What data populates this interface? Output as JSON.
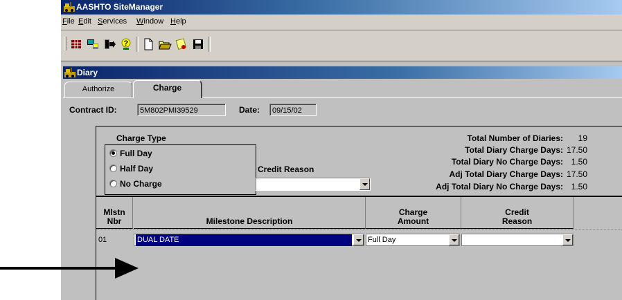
{
  "app": {
    "title": "AASHTO SiteManager"
  },
  "menu": [
    "File",
    "Edit",
    "Services",
    "Window",
    "Help"
  ],
  "menu_underline": [
    "F",
    "E",
    "S",
    "W",
    "H"
  ],
  "toolbar": {
    "icons": [
      "grid-icon",
      "workstation-icon",
      "exit-icon",
      "help-icon",
      "new-icon",
      "open-icon",
      "cut-icon",
      "save-icon"
    ]
  },
  "child_window": {
    "title": "Diary"
  },
  "tabs": [
    {
      "label": "Authorize",
      "active": false
    },
    {
      "label": "Charge",
      "active": true
    }
  ],
  "header": {
    "contract_label": "Contract ID:",
    "contract_value": "5M802PMI39529",
    "date_label": "Date:",
    "date_value": "09/15/02"
  },
  "charge_type": {
    "title": "Charge Type",
    "options": [
      {
        "label": "Full Day",
        "checked": true
      },
      {
        "label": "Half Day",
        "checked": false
      },
      {
        "label": "No Charge",
        "checked": false
      }
    ]
  },
  "credit_reason": {
    "label": "Credit Reason",
    "value": ""
  },
  "stats": [
    {
      "label": "Total Number of Diaries:",
      "value": "19"
    },
    {
      "label": "Total Diary Charge Days:",
      "value": "17.50"
    },
    {
      "label": "Total Diary No Charge Days:",
      "value": "1.50"
    },
    {
      "label": "Adj Total Diary Charge Days:",
      "value": "17.50"
    },
    {
      "label": "Adj Total Diary No Charge Days:",
      "value": "1.50"
    }
  ],
  "table": {
    "columns": [
      {
        "line1": "Mlstn",
        "line2": "Nbr"
      },
      {
        "line1": "",
        "line2": "Milestone Description"
      },
      {
        "line1": "Charge",
        "line2": "Amount"
      },
      {
        "line1": "Credit",
        "line2": "Reason"
      }
    ],
    "rows": [
      {
        "nbr": "01",
        "description": "DUAL DATE",
        "charge_amount": "Full Day",
        "credit_reason": ""
      }
    ]
  },
  "colors": {
    "selection": "#000080",
    "title_start": "#0a246a",
    "face": "#c0c0c0"
  }
}
